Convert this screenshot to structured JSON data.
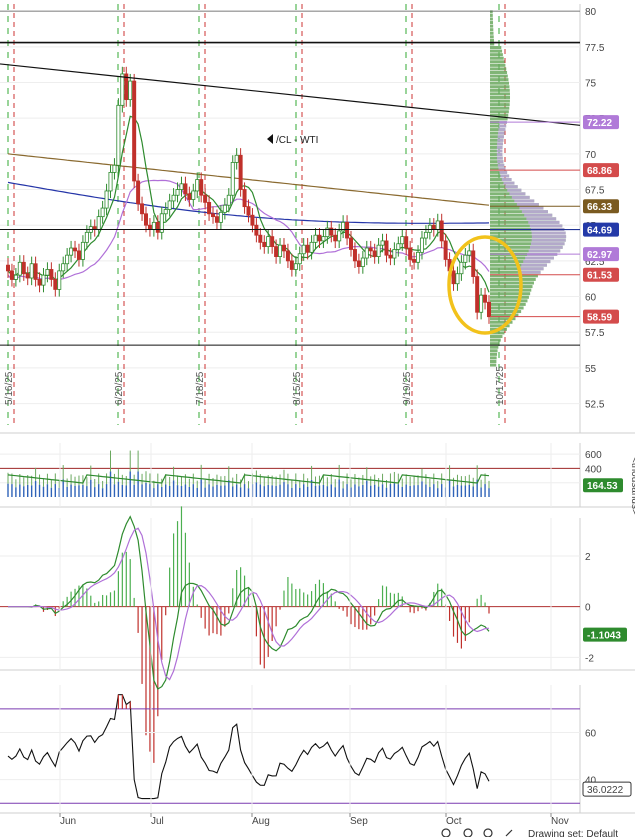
{
  "chart_data": [
    {
      "type": "candlestick",
      "panel": "price",
      "symbol": "/CL - WTI",
      "yticks": [
        80,
        77.5,
        75,
        72.5,
        70,
        67.5,
        65,
        62.5,
        60,
        57.5,
        55,
        52.5
      ],
      "ylim": [
        51,
        80.5
      ],
      "x_month_labels": [
        "Jun",
        "Jul",
        "Aug",
        "Sep",
        "Oct",
        "Nov"
      ],
      "date_markers": [
        "5/16/25",
        "6/20/25",
        "7/18/25",
        "8/15/25",
        "9/19/25",
        "10/17/25"
      ],
      "horizontal_levels": [
        77.8,
        64.7,
        56.6
      ],
      "trendline": {
        "from": 76.3,
        "to": 72.0
      },
      "price_badges": [
        {
          "label": "72.22",
          "value": 72.22,
          "color": "#b07ad8"
        },
        {
          "label": "68.86",
          "value": 68.86,
          "color": "#d44b4b"
        },
        {
          "label": "66.33",
          "value": 66.33,
          "color": "#7a5a20"
        },
        {
          "label": "64.69",
          "value": 64.69,
          "color": "#243aa8"
        },
        {
          "label": "62.97",
          "value": 62.97,
          "color": "#b07ad8"
        },
        {
          "label": "61.53",
          "value": 61.53,
          "color": "#d44b4b"
        },
        {
          "label": "58.59",
          "value": 58.59,
          "color": "#d44b4b"
        }
      ],
      "closes": [
        61.8,
        61.2,
        61.5,
        62.4,
        61.6,
        61.3,
        62.3,
        61.2,
        60.8,
        61.5,
        61.9,
        61.2,
        60.5,
        61.8,
        62.3,
        62.9,
        63.4,
        63.2,
        62.6,
        63.8,
        64.5,
        64.9,
        64.7,
        65.6,
        66.2,
        67.4,
        68.7,
        69.2,
        73.4,
        75.6,
        73.8,
        75.1,
        68.1,
        66.5,
        65.8,
        65.0,
        64.7,
        65.2,
        64.5,
        65.8,
        66.1,
        66.7,
        67.1,
        67.5,
        67.9,
        67.2,
        66.8,
        67.4,
        68.2,
        67.1,
        66.6,
        65.8,
        65.6,
        65.2,
        65.9,
        66.4,
        67.1,
        69.4,
        69.9,
        67.5,
        66.3,
        65.7,
        65.0,
        64.3,
        63.8,
        63.5,
        64.2,
        63.5,
        62.8,
        63.6,
        63.2,
        62.5,
        61.9,
        62.3,
        63.0,
        63.6,
        63.1,
        63.8,
        64.3,
        63.9,
        64.2,
        64.8,
        64.3,
        63.9,
        64.6,
        65.2,
        64.1,
        63.3,
        62.5,
        62.1,
        62.7,
        63.4,
        63.2,
        62.8,
        63.6,
        63.9,
        62.9,
        62.7,
        63.3,
        63.7,
        64.2,
        63.4,
        62.6,
        62.4,
        63.1,
        64.1,
        64.5,
        65.0,
        64.7,
        65.3,
        63.9,
        62.6,
        61.8,
        60.9,
        61.6,
        62.4,
        62.9,
        63.2,
        61.4,
        58.9,
        60.1,
        59.6,
        58.59
      ],
      "volume_axis": [
        600,
        400,
        200
      ],
      "volume_badge": "164.53",
      "volume_axis_title": "<thousands>",
      "macd_axis": [
        2,
        0,
        -2
      ],
      "macd_badge": "-1.1043",
      "rsi_axis": [
        60,
        40
      ],
      "rsi_badge": "36.0222",
      "rsi_levels": [
        70,
        30
      ]
    }
  ],
  "footer": {
    "drawing_label": "Drawing set: Default"
  }
}
